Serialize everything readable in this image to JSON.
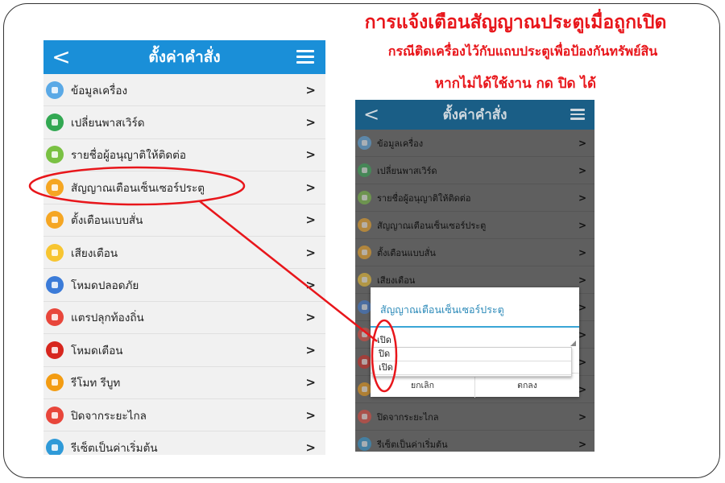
{
  "caption": {
    "line1": "การแจ้งเตือนสัญญาณประตูเมื่อถูกเปิด",
    "line2": "กรณีติดเครื่องไว้กับแถบประตูเพื่อป้องกันทรัพย์สิน",
    "line3": "หากไม่ได้ใช้งาน กด ปิด ได้"
  },
  "header": {
    "back": "<",
    "title": "ตั้งค่าคำสั่ง"
  },
  "menu": [
    {
      "label": "ข้อมูลเครื่อง",
      "icon": "device-info-icon",
      "color": "#5aa9e6"
    },
    {
      "label": "เปลี่ยนพาสเวิร์ด",
      "icon": "key-icon",
      "color": "#32a852"
    },
    {
      "label": "รายชื่อผู้อนุญาติให้ติดต่อ",
      "icon": "contacts-icon",
      "color": "#7ac143"
    },
    {
      "label": "สัญญาณเตือนเซ็นเซอร์ประตู",
      "icon": "sos-icon",
      "color": "#f5a623"
    },
    {
      "label": "ตั้งเตือนแบบสั่น",
      "icon": "vibrate-icon",
      "color": "#f5a623"
    },
    {
      "label": "เสียงเตือน",
      "icon": "sound-icon",
      "color": "#f7c531"
    },
    {
      "label": "โหมดปลอดภัย",
      "icon": "shield-icon",
      "color": "#3b7bd8"
    },
    {
      "label": "แตรปลุกท้องถิ่น",
      "icon": "horn-icon",
      "color": "#e8463b"
    },
    {
      "label": "โหมดเตือน",
      "icon": "alarm-icon",
      "color": "#d7261e"
    },
    {
      "label": "รีโมท รีบูท",
      "icon": "reboot-icon",
      "color": "#f39c12"
    },
    {
      "label": "ปิดจากระยะไกล",
      "icon": "power-icon",
      "color": "#e8463b"
    },
    {
      "label": "รีเซ็ตเป็นค่าเริ่มต้น",
      "icon": "reset-icon",
      "color": "#2f9ad8"
    }
  ],
  "chevron": ">",
  "dialog": {
    "title": "สัญญาณเตือนเซ็นเซอร์ประตู",
    "selected": "เปิด",
    "options": [
      "ปิด",
      "เปิด"
    ],
    "cancel": "ยกเลิก",
    "ok": "ตกลง"
  },
  "annotation_color": "#e8161b"
}
